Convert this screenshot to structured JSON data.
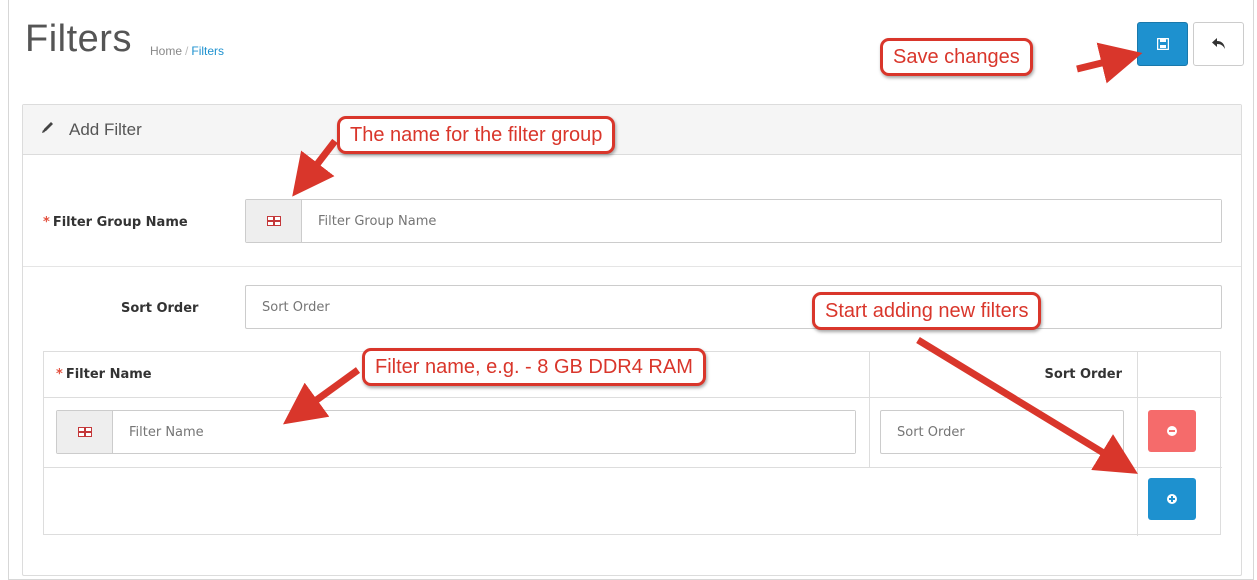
{
  "header": {
    "title": "Filters",
    "breadcrumb": {
      "home": "Home",
      "separator": "/",
      "current": "Filters"
    },
    "save_icon": "save-icon",
    "back_icon": "reply-icon"
  },
  "panel": {
    "heading": "Add Filter",
    "heading_icon": "pencil-icon",
    "group_name": {
      "label": "Filter Group Name",
      "placeholder": "Filter Group Name",
      "value": ""
    },
    "sort_order": {
      "label": "Sort Order",
      "placeholder": "Sort Order",
      "value": ""
    },
    "table": {
      "columns": {
        "name": "Filter Name",
        "sort": "Sort Order"
      },
      "rows": [
        {
          "name_placeholder": "Filter Name",
          "sort_placeholder": "Sort Order"
        }
      ]
    }
  },
  "callouts": {
    "save": "Save changes",
    "group_name": "The name for the filter group",
    "filter_name": "Filter name, e.g. - 8 GB DDR4 RAM",
    "add_filters": "Start adding new filters"
  },
  "colors": {
    "primary": "#1e91cf",
    "danger": "#f56b6b",
    "required": "#e3503e",
    "callout": "#d9362b"
  }
}
